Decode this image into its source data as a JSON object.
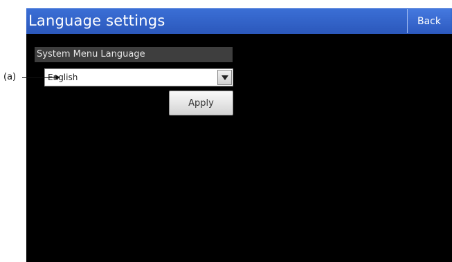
{
  "header": {
    "title": "Language settings",
    "back_label": "Back"
  },
  "section": {
    "label": "System Menu Language"
  },
  "language_select": {
    "selected_value": "English"
  },
  "apply_label": "Apply",
  "callout": {
    "label": "(a)"
  },
  "colors": {
    "titlebar": "#2b58bb",
    "screen_background": "#000000",
    "section_label_background": "#3e3e3e"
  },
  "icons": {
    "dropdown": "chevron-down-icon"
  }
}
